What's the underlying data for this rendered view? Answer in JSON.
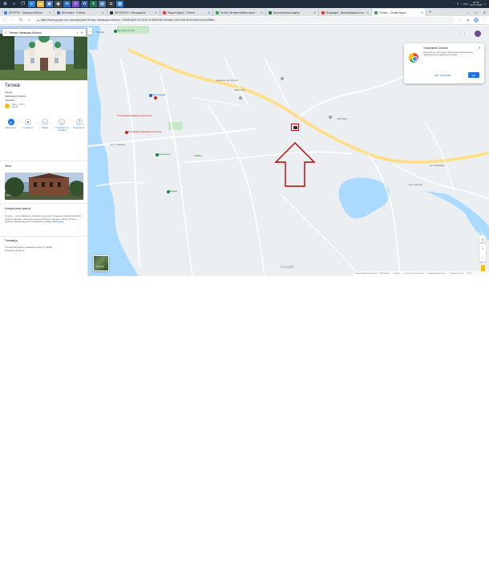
{
  "taskbar": {
    "icons": [
      {
        "name": "start-icon",
        "glyph": "⊞",
        "color": "#1f2d3a"
      },
      {
        "name": "search-icon",
        "glyph": "⌕",
        "color": "#1f2d3a"
      },
      {
        "name": "taskview-icon",
        "glyph": "❐",
        "color": "#1f2d3a"
      },
      {
        "name": "edge-icon",
        "glyph": "e",
        "color": "#2a7fd4"
      },
      {
        "name": "explorer-icon",
        "glyph": "▬",
        "color": "#e8b43a"
      },
      {
        "name": "store-icon",
        "glyph": "▣",
        "color": "#3b6fc4"
      },
      {
        "name": "chrome-icon",
        "glyph": "◉",
        "color": "#4a4a4a"
      },
      {
        "name": "mail-icon",
        "glyph": "✉",
        "color": "#2d6fb8"
      },
      {
        "name": "viber-icon",
        "glyph": "✆",
        "color": "#7a4fc4"
      },
      {
        "name": "word-icon",
        "glyph": "W",
        "color": "#2b579a"
      },
      {
        "name": "excel-icon",
        "glyph": "X",
        "color": "#217346"
      },
      {
        "name": "photos-icon",
        "glyph": "▤",
        "color": "#4a6fa5"
      },
      {
        "name": "camera-icon",
        "glyph": "◘",
        "color": "#3a3a3a"
      },
      {
        "name": "calendar-icon",
        "glyph": "▦",
        "color": "#2b7cd3"
      }
    ],
    "lang": "РУС",
    "time": "23:09",
    "date": "19.07.2020"
  },
  "tabs": [
    {
      "label": "DPOPTIK - Загрузка Файлов",
      "color": "#4285f4",
      "active": false
    },
    {
      "label": "ВКонтакте - Ответы",
      "color": "#4a76a8",
      "active": false
    },
    {
      "label": "АВТОЗАЛІТ • Нахождение",
      "color": "#333333",
      "active": false
    },
    {
      "label": "Яндекс.Карты - Тетиєв",
      "color": "#ff3333",
      "active": false
    },
    {
      "label": "Геоби | Интерактивная карта",
      "color": "#34a853",
      "active": false
    },
    {
      "label": "Бухгалтерская задача",
      "color": "#188038",
      "active": false
    },
    {
      "label": "Входящие - lakimsa@gmail.com",
      "color": "#ea4335",
      "active": false
    },
    {
      "label": "Тетиєв – Google Карты",
      "color": "#34a853",
      "active": true
    }
  ],
  "address_bar": {
    "url": "https://www.google.com.ua/maps/place/Тетиєв,+Киевская+область,+09800/@49.3712925,29.6829938,15z/data=!3m1!4b1!4m5!3m4!1s0x40d38f5c..."
  },
  "panel": {
    "search_value": "Тетиєв, Киевская область",
    "place_name": "Тетиєв",
    "subtitle": "Город",
    "region": "Киевская область",
    "country": "Украина",
    "weather_line1": "Ясно · 23°C",
    "weather_line2": "23:00",
    "actions": [
      {
        "label": "Маршруты",
        "glyph": "➤",
        "icon": "directions-icon"
      },
      {
        "label": "Сохранить",
        "glyph": "⚑",
        "icon": "bookmark-icon"
      },
      {
        "label": "Рядом",
        "glyph": "⌕",
        "icon": "nearby-icon"
      },
      {
        "label": "Отправить на телефон",
        "glyph": "▯",
        "icon": "phone-icon"
      },
      {
        "label": "Поделиться",
        "glyph": "⤴",
        "icon": "share-icon"
      }
    ],
    "photos_title": "Фото",
    "photo_caption": "Фото",
    "facts_title": "Интересные факты",
    "facts_text": "Тетиев — город районного значения в центре Тетиевского района Киевской области Украины. Находится на реке Роська в 144 км от Киева. Тетиев — административный центр Тетиевской громады.",
    "facts_source": "Википедия",
    "labels_title": "Тетиевцы",
    "address_line1": "Тетиевский район, Киевская область, 09800",
    "address_line2": "Показать на карте"
  },
  "map": {
    "top_label": "Тетиев",
    "labels": [
      {
        "text": "Ресторан Тетиев",
        "kind": "green"
      },
      {
        "text": "Церковь Св. Георгия",
        "kind": ""
      },
      {
        "text": "Тетиевский краеведческий музей",
        "kind": "red"
      },
      {
        "text": "Школа №1",
        "kind": ""
      },
      {
        "text": "АЗС WOG",
        "kind": ""
      },
      {
        "text": "Автостанция",
        "kind": "blue"
      },
      {
        "text": "Тетиевская районная больница",
        "kind": "red"
      },
      {
        "text": "Ельдорадо",
        "kind": "green"
      },
      {
        "text": "ОКЕАН",
        "kind": "green"
      },
      {
        "text": "Родник",
        "kind": "green"
      },
      {
        "text": "вул. Соборна",
        "kind": ""
      },
      {
        "text": "вул. Київська",
        "kind": ""
      },
      {
        "text": "вул. Шевченка",
        "kind": ""
      }
    ],
    "popup": {
      "title": "Установите Chrome",
      "body": "Пользуйтесь быстрым и безопасным браузером с официальной поддержкой Google",
      "no_label": "НЕТ, СПАСИБО",
      "yes_label": "ДА"
    },
    "satellite_label": "Спутник",
    "google_logo": "Google",
    "footer": [
      "Картографические данные © 2020 Google",
      "Украина",
      "Условия использования",
      "Конфиденциальность",
      "Отправить отзыв",
      "200 м"
    ]
  },
  "colors": {
    "taskbar": "#1f2d3a",
    "accent": "#1a73e8",
    "water": "#aadaff",
    "road_major": "#fde293",
    "marker": "#c00000",
    "arrow": "#c00000"
  }
}
